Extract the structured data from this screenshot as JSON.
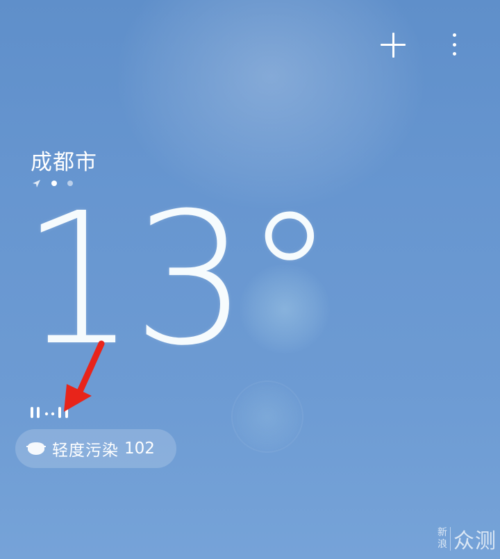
{
  "header": {
    "add_icon": "plus-icon",
    "more_icon": "more-vertical-icon"
  },
  "location": {
    "city": "成都市",
    "indicator_icon": "location-arrow-icon",
    "page_count": 2,
    "active_page": 1
  },
  "weather": {
    "temperature": "13°"
  },
  "status_indicator": {
    "icon": "signal-bars-icon"
  },
  "annotation": {
    "icon": "red-arrow-icon",
    "color": "#e8241a"
  },
  "air_quality": {
    "icon": "mask-icon",
    "label": "轻度污染",
    "value": "102"
  },
  "watermark": {
    "line1": "新",
    "line2": "浪",
    "main": "众测"
  },
  "colors": {
    "background_top": "#5f8fca",
    "background_bottom": "#76a3d8",
    "text": "#ffffff"
  }
}
